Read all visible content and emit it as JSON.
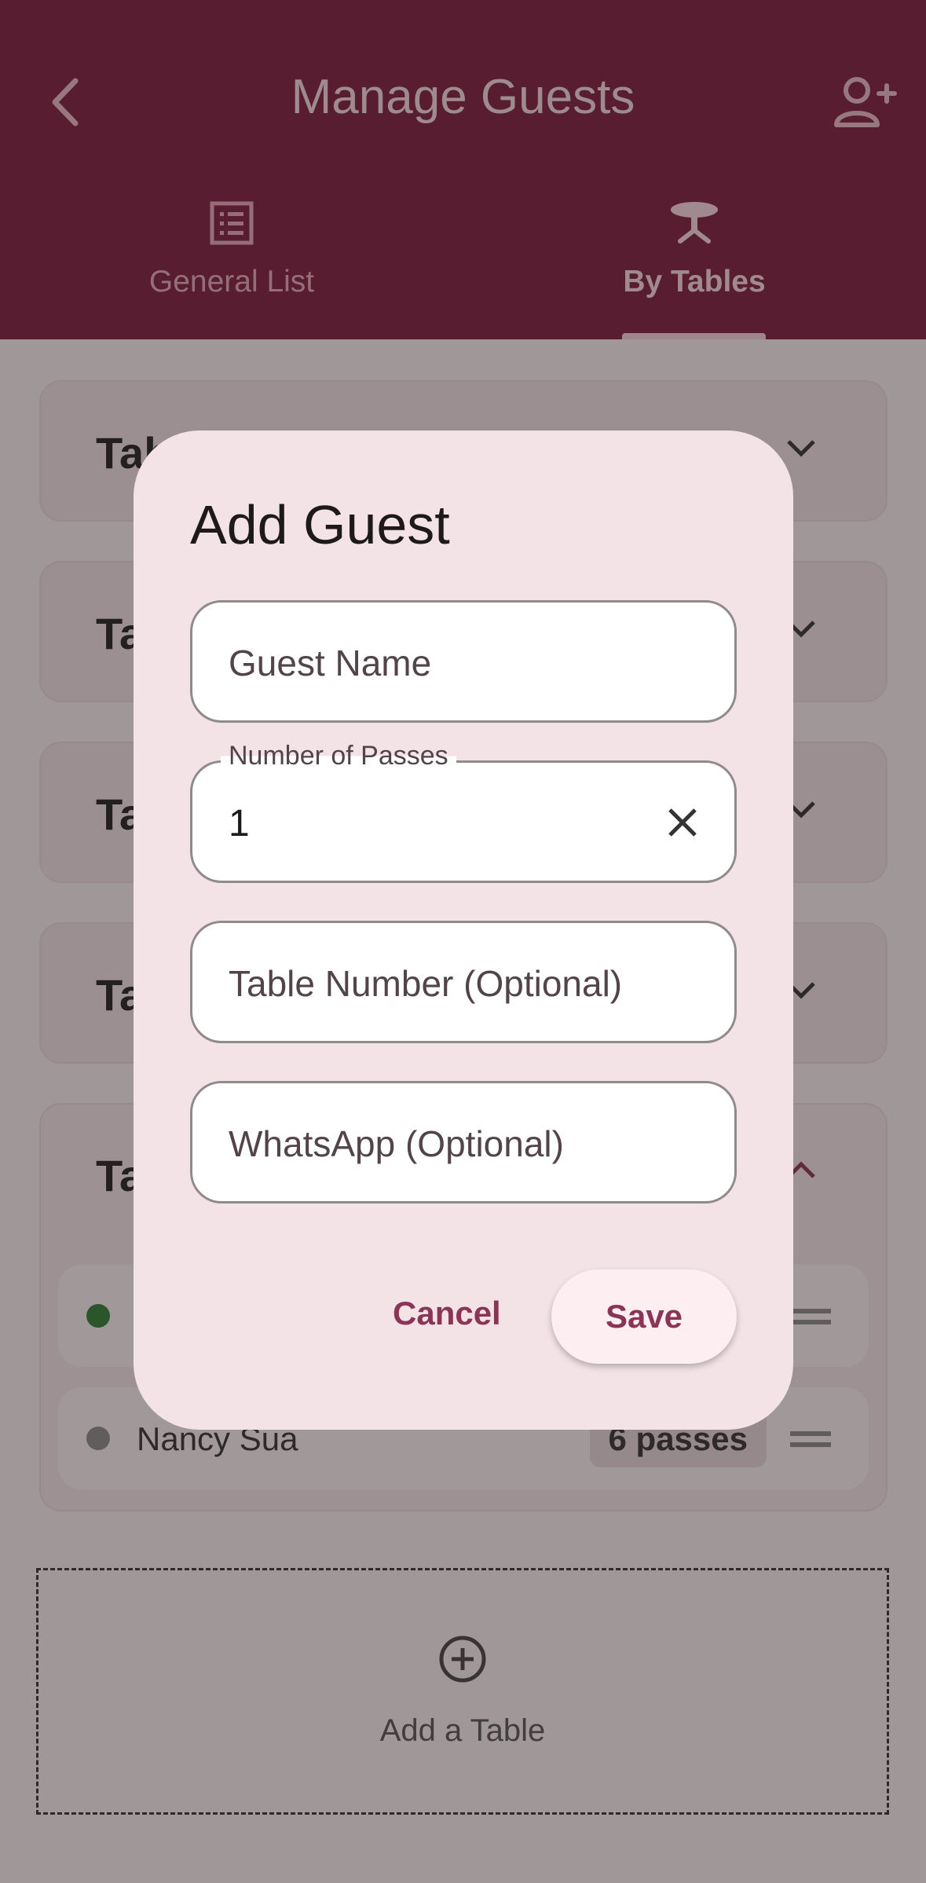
{
  "app_bar": {
    "title": "Manage Guests",
    "back_icon": "chevron-left-icon",
    "add_guest_icon": "person-add-icon"
  },
  "tabs": [
    {
      "label": "General List",
      "icon": "list-icon",
      "selected": false
    },
    {
      "label": "By Tables",
      "icon": "table-icon",
      "selected": true
    }
  ],
  "tables": [
    {
      "label_visible": "Tab"
    },
    {
      "label_visible": "Ta"
    },
    {
      "label_visible": "Ta"
    },
    {
      "label_visible": "Ta"
    },
    {
      "label_visible": "Ta"
    }
  ],
  "guests": [
    {
      "name": "",
      "passes": "",
      "status_color": "#2e7d32"
    },
    {
      "name": "Nancy Sua",
      "passes": "6 passes",
      "status_color": "#8a8a8a"
    }
  ],
  "add_table": {
    "label": "Add a Table",
    "icon": "add-circle-icon"
  },
  "dialog": {
    "title": "Add Guest",
    "guest_name": {
      "placeholder": "Guest Name",
      "value": ""
    },
    "passes": {
      "label": "Number of Passes",
      "value": "1"
    },
    "table_number": {
      "placeholder": "Table Number (Optional)",
      "value": ""
    },
    "whatsapp": {
      "placeholder": "WhatsApp (Optional)",
      "value": ""
    },
    "cancel_label": "Cancel",
    "save_label": "Save"
  },
  "colors": {
    "brand": "#7b1d3d",
    "accent_text": "#8a3555",
    "dialog_bg": "#f3e3e6"
  }
}
